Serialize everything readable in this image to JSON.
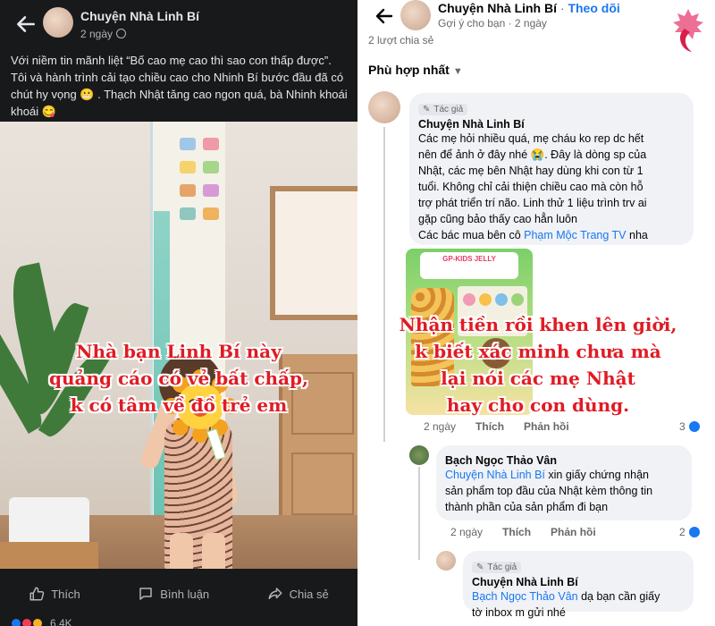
{
  "left_post": {
    "author": "Chuyện Nhà Linh Bí",
    "time": "2 ngày",
    "caption": "Với niềm tin mãnh liệt “Bố cao mẹ cao thì sao con thấp được”. Tôi và hành trình cải tạo chiều cao cho Nhinh Bí bước đầu đã có chút hy vọng 😬 . Thạch Nhật tăng cao ngon quá, bà Nhinh khoái khoái 😋",
    "overlay_text": [
      "Nhà bạn Linh Bí này",
      "quảng cáo có vẻ bất chấp,",
      "k có tâm về đồ trẻ em"
    ],
    "actions": {
      "like": "Thích",
      "comment": "Bình luận",
      "share": "Chia sẻ"
    },
    "reactions_count": "6,4K"
  },
  "right_post": {
    "author": "Chuyện Nhà Linh Bí",
    "follow": "Theo dõi",
    "subline": "Gợi ý cho bạn · 2 ngày",
    "shares_partial": "2 lượt chia sẻ",
    "sort_label": "Phù hợp nhất",
    "comment1": {
      "badge": "Tác giả",
      "name": "Chuyện Nhà Linh Bí",
      "lines": [
        "Các mẹ hỏi nhiều quá, mẹ cháu ko rep dc hết",
        "nên để ảnh ở đây nhé 😭. Đây là dòng sp của",
        "Nhật, các mẹ bên Nhật hay dùng khi con từ 1",
        "tuổi.  Không chỉ cải thiện chiều cao mà còn hỗ",
        "trợ phát triển trí não. Linh thử 1 liệu trình trv ai",
        "gặp cũng bảo thấy cao hẳn luôn"
      ],
      "last_line_prefix": "Các bác mua bên cô ",
      "last_line_mention": "Phạm Mộc Trang TV",
      "last_line_suffix": " nha",
      "product_banner": "GP-KIDS JELLY",
      "meta": {
        "time": "2 ngày",
        "like": "Thích",
        "reply": "Phản hồi"
      },
      "like_count": "3"
    },
    "comment2": {
      "name": "Bạch Ngọc Thảo Vân",
      "mention": "Chuyện Nhà Linh Bí",
      "text_first": " xin giấy chứng nhận",
      "lines": [
        "sản phẩm top đầu của Nhật kèm thông tin",
        "thành phần của sản phẩm đi bạn"
      ],
      "meta": {
        "time": "2 ngày",
        "like": "Thích",
        "reply": "Phản hồi"
      },
      "like_count": "2"
    },
    "comment3": {
      "badge": "Tác giả",
      "name": "Chuyện Nhà Linh Bí",
      "mention": "Bạch Ngọc Thảo Vân",
      "text_first": " dạ bạn cần giấy",
      "line2": "tờ inbox m gửi nhé"
    },
    "overlay_text": [
      "Nhận tiền rồi khen lên giời,",
      "k biết xác minh chưa mà",
      "lại nói các mẹ Nhật",
      "hay cho con dùng."
    ]
  },
  "colors": {
    "accent_blue": "#1877f2",
    "overlay_red": "#e01b24",
    "dark_bg": "#18191a"
  }
}
